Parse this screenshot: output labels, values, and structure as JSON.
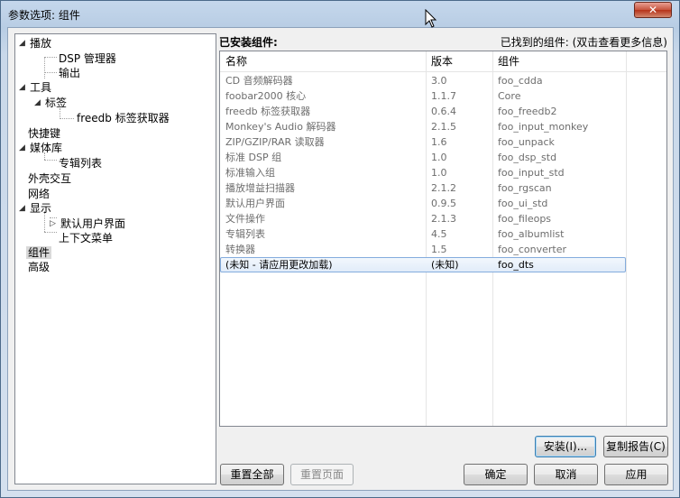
{
  "window": {
    "title": "参数选项: 组件",
    "close_label": "✕"
  },
  "tree": {
    "items": [
      {
        "label": "播放",
        "expander": "◢"
      },
      {
        "label": "DSP 管理器"
      },
      {
        "label": "输出"
      },
      {
        "label": "工具",
        "expander": "◢"
      },
      {
        "label": "标签",
        "expander": "◢"
      },
      {
        "label": "freedb 标签获取器"
      },
      {
        "label": "快捷键"
      },
      {
        "label": "媒体库",
        "expander": "◢"
      },
      {
        "label": "专辑列表"
      },
      {
        "label": "外壳交互"
      },
      {
        "label": "网络"
      },
      {
        "label": "显示",
        "expander": "◢"
      },
      {
        "label": "默认用户界面",
        "expander": "▷"
      },
      {
        "label": "上下文菜单"
      },
      {
        "label": "组件"
      },
      {
        "label": "高级"
      }
    ]
  },
  "installed": {
    "title": "已安装组件:",
    "found_info": "已找到的组件:  (双击查看更多信息)",
    "columns": [
      "名称",
      "版本",
      "组件"
    ],
    "rows": [
      [
        "CD 音频解码器",
        "3.0",
        "foo_cdda"
      ],
      [
        "foobar2000 核心",
        "1.1.7",
        "Core"
      ],
      [
        "freedb 标签获取器",
        "0.6.4",
        "foo_freedb2"
      ],
      [
        "Monkey's Audio 解码器",
        "2.1.5",
        "foo_input_monkey"
      ],
      [
        "ZIP/GZIP/RAR 读取器",
        "1.6",
        "foo_unpack"
      ],
      [
        "标准 DSP 组",
        "1.0",
        "foo_dsp_std"
      ],
      [
        "标准输入组",
        "1.0",
        "foo_input_std"
      ],
      [
        "播放增益扫描器",
        "2.1.2",
        "foo_rgscan"
      ],
      [
        "默认用户界面",
        "0.9.5",
        "foo_ui_std"
      ],
      [
        "文件操作",
        "2.1.3",
        "foo_fileops"
      ],
      [
        "专辑列表",
        "4.5",
        "foo_albumlist"
      ],
      [
        "转换器",
        "1.5",
        "foo_converter"
      ],
      [
        "(未知 - 请应用更改加载)",
        "(未知)",
        "foo_dts"
      ]
    ]
  },
  "buttons": {
    "install": "安装(I)...",
    "copy_report": "复制报告(C)",
    "reset_all": "重置全部",
    "reset_page": "重置页面",
    "ok": "确定",
    "cancel": "取消",
    "apply": "应用"
  }
}
